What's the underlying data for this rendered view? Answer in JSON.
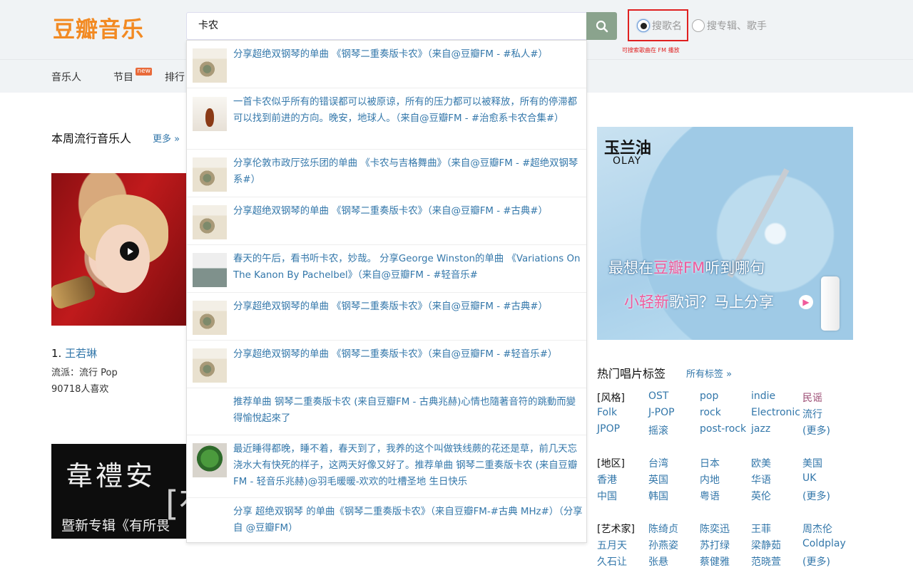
{
  "header": {
    "logo": "豆瓣音乐",
    "search_value": "卡农",
    "search_icon": "search-icon",
    "radio_song": "搜歌名",
    "radio_album": "搜专辑、歌手",
    "hint": "可搜索歌曲在 FM 播放"
  },
  "nav": {
    "items": [
      "音乐人",
      "节目",
      "排行"
    ],
    "new_badge": "new"
  },
  "left": {
    "section_title": "本周流行音乐人",
    "more": "更多 »",
    "artist": {
      "rank": "1.",
      "name": "王若琳",
      "genre": "流派：流行 Pop",
      "likes": "90718人喜欢"
    },
    "banner": {
      "title": "韋禮安",
      "subtitle": "暨新专辑《有所畏",
      "bracket": "[有"
    }
  },
  "suggestions": [
    {
      "text": "分享超绝双钢琴的单曲 《钢琴二重奏版卡农》（来自@豆瓣FM - #私人#）",
      "thumb": "cover"
    },
    {
      "text": "一首卡农似乎所有的错误都可以被原谅，所有的压力都可以被释放，所有的停滞都可以找到前进的方向。晚安，地球人。（来自@豆瓣FM - #治愈系卡农合集#）",
      "thumb": "violin"
    },
    {
      "text": "分享伦敦市政厅弦乐团的单曲 《卡农与吉格舞曲》（来自@豆瓣FM - #超绝双钢琴 系#）",
      "thumb": "cover"
    },
    {
      "text": "分享超绝双钢琴的单曲 《钢琴二重奏版卡农》（来自@豆瓣FM - #古典#）",
      "thumb": "cover"
    },
    {
      "text": "春天的午后，看书听卡农，妙哉。 分享George Winston的单曲 《Variations On The Kanon By Pachelbel》（来自@豆瓣FM - #轻音乐#",
      "thumb": "piano"
    },
    {
      "text": "分享超绝双钢琴的单曲 《钢琴二重奏版卡农》（来自@豆瓣FM - #古典#）",
      "thumb": "cover"
    },
    {
      "text": "分享超绝双钢琴的单曲 《钢琴二重奏版卡农》（来自@豆瓣FM - #轻音乐#）",
      "thumb": "cover"
    },
    {
      "text": "推荐单曲 钢琴二重奏版卡农 (来自豆瓣FM - 古典兆赫)心情也隨著音符的跳動而變得愉悅起來了",
      "thumb": ""
    },
    {
      "text": "最近睡得都晚，睡不着，春天到了，我养的这个叫做铁线蕨的花还是草，前几天忘浇水大有快死的样子，这两天好像又好了。推荐单曲 钢琴二重奏版卡农 (来自豆瓣FM - 轻音乐兆赫)@羽毛暖暖-欢欢的吐槽圣地 生日快乐",
      "thumb": "plant"
    },
    {
      "text": "分享 超绝双钢琴 的单曲《钢琴二重奏版卡农》（来自豆瓣FM-#古典 MHz#）（分享自 @豆瓣FM）",
      "thumb": ""
    }
  ],
  "ad": {
    "brand_cn": "玉兰油",
    "brand_en": "OLAY",
    "line1_pre": "最想在",
    "line1_hl": "豆瓣FM",
    "line1_post": "听到哪句",
    "line2_pink": "小轻新",
    "line2_rest": "歌词？马上分享",
    "arrow": "▶"
  },
  "tags": {
    "title": "热门唱片标签",
    "more": "所有标签 »",
    "groups": [
      {
        "label": "[风格]",
        "items": [
          "OST",
          "pop",
          "indie",
          "民谣",
          "Folk",
          "J-POP",
          "rock",
          "Electronic",
          "流行",
          "JPOP",
          "摇滚",
          "post-rock",
          "jazz",
          "(更多)"
        ]
      },
      {
        "label": "[地区]",
        "items": [
          "台湾",
          "日本",
          "欧美",
          "美国",
          "香港",
          "英国",
          "内地",
          "华语",
          "UK",
          "中国",
          "韩国",
          "粤语",
          "英伦",
          "(更多)"
        ]
      },
      {
        "label": "[艺术家]",
        "items": [
          "陈绮贞",
          "陈奕迅",
          "王菲",
          "周杰伦",
          "五月天",
          "孙燕姿",
          "苏打绿",
          "梁静茹",
          "Coldplay",
          "久石让",
          "张悬",
          "蔡健雅",
          "范晓萱",
          "(更多)"
        ]
      }
    ]
  },
  "colors": {
    "brand": "#f28a23",
    "link": "#3377aa",
    "search_btn": "#8aa38d",
    "highlight_box": "#e02020"
  }
}
